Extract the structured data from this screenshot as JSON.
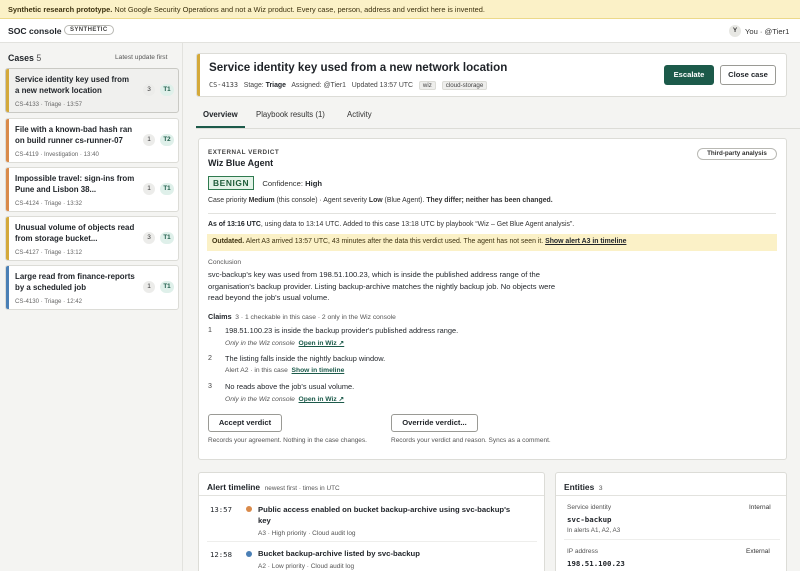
{
  "banner": {
    "strong": "Synthetic research prototype.",
    "text": " Not Google Security Operations and not a Wiz product. Every case, person, address and verdict here is invented."
  },
  "topbar": {
    "app": "SOC console",
    "badge": "SYNTHETIC",
    "avatar": "Y",
    "user": "You · @Tier1"
  },
  "sidebar": {
    "title": "Cases",
    "count": "5",
    "sort": "Latest update first",
    "cases": [
      {
        "title": "Service identity key used from a new network location",
        "meta": "CS-4133 · Triage · 13:57",
        "count": "3",
        "tier": "T1",
        "color": "#d4a93a"
      },
      {
        "title": "File with a known-bad hash ran on build runner cs-runner-07",
        "meta": "CS-4119 · Investigation · 13:40",
        "count": "1",
        "tier": "T2",
        "color": "#d98a4a"
      },
      {
        "title": "Impossible travel: sign-ins from Pune and Lisbon 38...",
        "meta": "CS-4124 · Triage · 13:32",
        "count": "1",
        "tier": "T1",
        "color": "#d98a4a"
      },
      {
        "title": "Unusual volume of objects read from storage bucket...",
        "meta": "CS-4127 · Triage · 13:12",
        "count": "3",
        "tier": "T1",
        "color": "#d4a93a"
      },
      {
        "title": "Large read from finance-reports by a scheduled job",
        "meta": "CS-4130 · Triage · 12:42",
        "count": "1",
        "tier": "T1",
        "color": "#4a7fb5"
      }
    ]
  },
  "header": {
    "title": "Service identity key used from a new network location",
    "id": "CS-4133",
    "stage_label": "Stage:",
    "stage": "Triage",
    "assigned": "Assigned: @Tier1",
    "updated": "Updated 13:57 UTC",
    "tags": [
      "wiz",
      "cloud-storage"
    ],
    "escalate": "Escalate",
    "close": "Close case"
  },
  "tabs": [
    "Overview",
    "Playbook results (1)",
    "Activity"
  ],
  "verdict": {
    "kicker": "EXTERNAL VERDICT",
    "source": "Wiz Blue Agent",
    "badge": "Third-party analysis",
    "verdict": "BENIGN",
    "confidence_label": "Confidence:",
    "confidence": "High",
    "priority_a": "Case priority ",
    "priority_b": "Medium",
    "priority_c": " (this console) · Agent severity ",
    "priority_d": "Low",
    "priority_e": " (Blue Agent). ",
    "priority_f": "They differ; neither has been changed.",
    "asof_a": "As of 13:16 UTC",
    "asof_b": ", using data to 13:14 UTC. Added to this case 13:18 UTC by playbook “Wiz – Get Blue Agent analysis”.",
    "outdated_a": "Outdated.",
    "outdated_b": " Alert A3 arrived 13:57 UTC, 43 minutes after the data this verdict used. The agent has not seen it. ",
    "outdated_link": "Show alert A3 in timeline",
    "conclusion_label": "Conclusion",
    "conclusion": [
      "svc-backup's key was used from 198.51.100.23, which is inside the published address range of the",
      "organisation's backup provider. Listing backup-archive matches the nightly backup job. No objects were",
      "read beyond the job's usual volume."
    ],
    "claims_label": "Claims",
    "claims_meta": "3 · 1 checkable in this case · 2 only in the Wiz console",
    "claims": [
      {
        "n": "1",
        "text": "198.51.100.23 is inside the backup provider's published address range.",
        "sub": "Only in the Wiz console",
        "link": "Open in Wiz ↗"
      },
      {
        "n": "2",
        "text": "The listing falls inside the nightly backup window.",
        "sub": "Alert A2 · in this case",
        "link": "Show in timeline"
      },
      {
        "n": "3",
        "text": "No reads above the job's usual volume.",
        "sub": "Only in the Wiz console",
        "link": "Open in Wiz ↗"
      }
    ],
    "accept": "Accept verdict",
    "accept_help": "Records your agreement. Nothing in the case changes.",
    "override": "Override verdict...",
    "override_help": "Records your verdict and reason. Syncs as a comment."
  },
  "timeline": {
    "title": "Alert timeline",
    "sub": "newest first · times in UTC",
    "items": [
      {
        "time": "13:57",
        "title": "Public access enabled on bucket backup-archive using svc-backup's",
        "title2": "key",
        "meta": "A3 · High priority · Cloud audit log",
        "color": "#d98a4a"
      },
      {
        "time": "12:58",
        "title": "Bucket backup-archive listed by svc-backup",
        "title2": "",
        "meta": "A2 · Low priority · Cloud audit log",
        "color": "#4a7fb5"
      }
    ]
  },
  "entities": {
    "title": "Entities",
    "count": "3",
    "items": [
      {
        "type": "Service identity",
        "value": "svc-backup",
        "scope": "Internal",
        "sub": "In alerts A1, A2, A3"
      },
      {
        "type": "IP address",
        "value": "198.51.100.23",
        "scope": "External",
        "sub": ""
      }
    ]
  }
}
